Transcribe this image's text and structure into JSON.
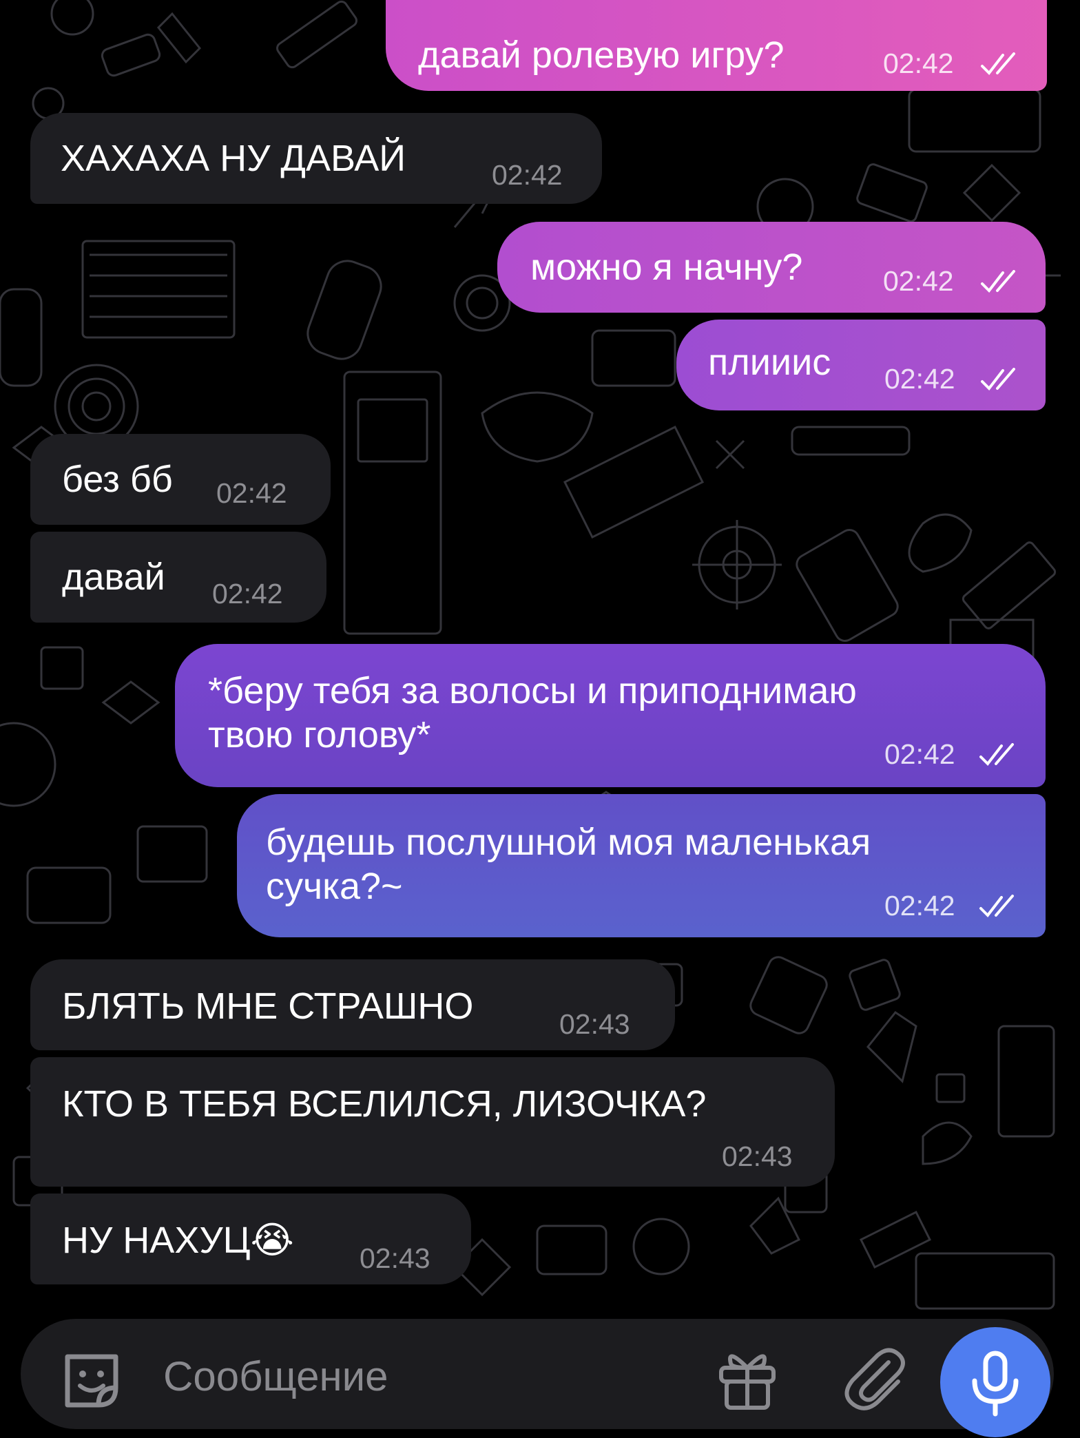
{
  "colors": {
    "background": "#000000",
    "incoming_bubble": "#1e1e22",
    "outgoing_pink": "#e35dbb",
    "outgoing_violet": "#7245c4",
    "outgoing_blue": "#5a60cc",
    "mic_button": "#4f7df0",
    "pattern_stroke": "#3a3a40"
  },
  "messages": [
    {
      "direction": "outgoing",
      "text": "давай ролевую игру?",
      "time": "02:42",
      "status": "read"
    },
    {
      "direction": "incoming",
      "text": "ХАХАХА НУ ДАВАЙ",
      "time": "02:42"
    },
    {
      "direction": "outgoing",
      "text": "можно я начну?",
      "time": "02:42",
      "status": "read"
    },
    {
      "direction": "outgoing",
      "text": "плииис",
      "time": "02:42",
      "status": "read"
    },
    {
      "direction": "incoming",
      "text": "без бб",
      "time": "02:42"
    },
    {
      "direction": "incoming",
      "text": "давай",
      "time": "02:42"
    },
    {
      "direction": "outgoing",
      "text": "*беру тебя за волосы и приподнимаю\nтвою голову*",
      "time": "02:42",
      "status": "read"
    },
    {
      "direction": "outgoing",
      "text": "будешь послушной моя маленькая\nсучка?~",
      "time": "02:42",
      "status": "read"
    },
    {
      "direction": "incoming",
      "text": "БЛЯТЬ МНЕ СТРАШНО",
      "time": "02:43"
    },
    {
      "direction": "incoming",
      "text": "КТО В ТЕБЯ ВСЕЛИЛСЯ, ЛИЗОЧКА?",
      "time": "02:43"
    },
    {
      "direction": "incoming",
      "text": "НУ НАХУЦ😭",
      "time": "02:43"
    }
  ],
  "composer": {
    "placeholder": "Сообщение",
    "value": "",
    "sticker_icon": "sticker-icon",
    "gift_icon": "gift-icon",
    "attach_icon": "paperclip-icon",
    "mic_icon": "microphone-icon"
  }
}
